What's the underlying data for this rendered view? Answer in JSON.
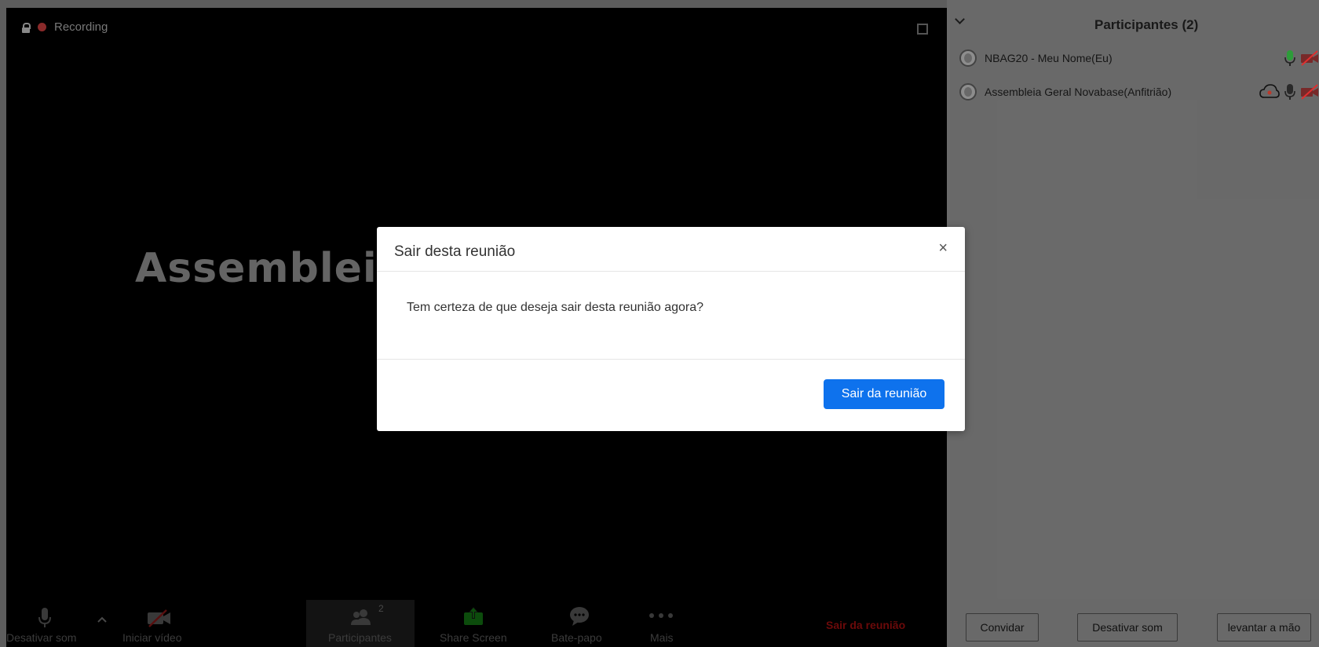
{
  "meeting": {
    "recording_label": "Recording",
    "speaker_name": "Assemblei"
  },
  "toolbar": {
    "mute_label": "Desativar som",
    "video_label": "Iniciar vídeo",
    "participants_label": "Participantes",
    "participants_count": "2",
    "share_label": "Share Screen",
    "chat_label": "Bate-papo",
    "more_label": "Mais",
    "leave_label": "Sair da reunião"
  },
  "dialog": {
    "title": "Sair desta reunião",
    "close_glyph": "×",
    "message": "Tem certeza de que deseja sair desta reunião agora?",
    "confirm_label": "Sair da reunião"
  },
  "panel": {
    "title": "Participantes (2)",
    "participants": [
      {
        "name": "NBAG20 - Meu Nome(Eu)"
      },
      {
        "name": "Assembleia Geral Novabase(Anfitrião)"
      }
    ],
    "footer": {
      "invite_label": "Convidar",
      "mute_all_label": "Desativar som",
      "raise_hand_label": "levantar a mão"
    }
  },
  "colors": {
    "accent": "#0e72ed",
    "mic_on": "#2e9e3a",
    "video_off": "#e23030"
  }
}
